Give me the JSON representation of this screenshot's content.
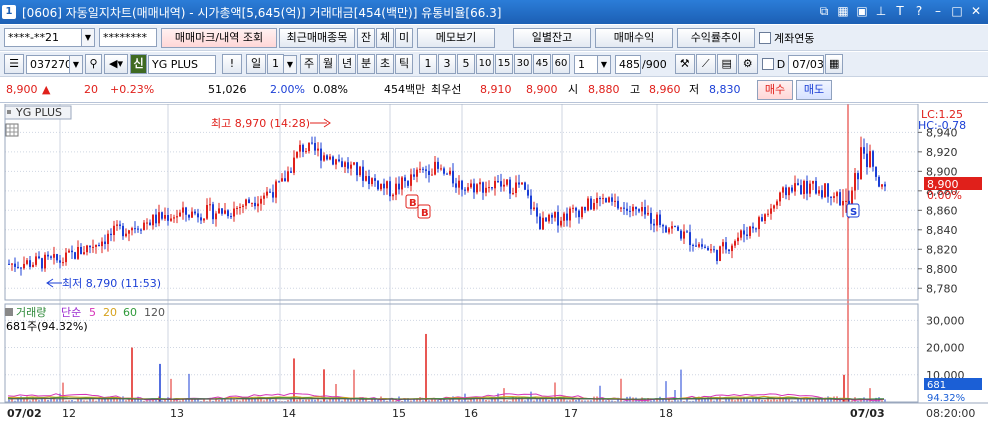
{
  "window": {
    "number": "1",
    "title": "[0606] 자동일지차트(매매내역) - 시가총액[5,645(억)] 거래대금[454(백만)] 유통비율[66.3]"
  },
  "toolbar1": {
    "account": "****-**21",
    "password": "********",
    "trade_mark_button": "매매마크/내역 조회",
    "recent_items_button": "최근매매종목",
    "jan_button": "잔",
    "che_button": "체",
    "mi_button": "미",
    "memo_button": "메모보기",
    "daily_balance_button": "일별잔고",
    "trade_profit_button": "매매수익",
    "return_trend_button": "수익률추이",
    "account_link_label": "계좌연동"
  },
  "toolbar2": {
    "code": "037270",
    "credit_badge": "신",
    "stock_name": "YG PLUS",
    "exclaim_button": "!",
    "period_label": "일",
    "period_count": "1",
    "periods": [
      "주",
      "월",
      "년",
      "분",
      "초",
      "틱"
    ],
    "selected_period": "분",
    "intervals": [
      "1",
      "3",
      "5",
      "10",
      "15",
      "30",
      "45",
      "60"
    ],
    "selected_interval": "1",
    "custom_interval": "1",
    "page_counter": "485",
    "page_total": "/900",
    "d_label": "D",
    "date": "07/03"
  },
  "quote": {
    "price": "8,900",
    "change": "20",
    "change_pct": "+0.23%",
    "volume": "51,026",
    "vol_ratio": "2.00%",
    "turnover": "0.08%",
    "amount": "454백만",
    "best_label": "최우선",
    "ask": "8,910",
    "bid": "8,900",
    "open_label": "시",
    "open": "8,880",
    "high_label": "고",
    "high": "8,960",
    "low_label": "저",
    "low": "8,830",
    "buy_button": "매수",
    "sell_button": "매도"
  },
  "chart_data": {
    "type": "candlestick",
    "symbol_label": "YG PLUS",
    "price_axis": {
      "ticks": [
        "8,940",
        "8,920",
        "8,900",
        "8,880",
        "8,860",
        "8,840",
        "8,820",
        "8,800",
        "8,780"
      ],
      "ylim": [
        8770,
        8965
      ],
      "lc_label": "LC:1.25",
      "hc_label": "HC:-0.78",
      "current_price": "8,900",
      "current_pct": "0.00%"
    },
    "annotations": {
      "high": "최고 8,970 (14:28)",
      "low": "최저 8,790 (11:53)",
      "buy_marks": [
        "B",
        "B"
      ],
      "sell_mark": "S"
    },
    "x_labels": [
      "07/02",
      "12",
      "13",
      "14",
      "15",
      "16",
      "17",
      "18",
      "07/03"
    ],
    "time_label": "08:20:00",
    "volume_panel": {
      "legend": [
        "거래량",
        "단순",
        "5",
        "20",
        "60",
        "120"
      ],
      "legend_colors": [
        "#2f8a3a",
        "#9a2ad0",
        "#d633b8",
        "#d6a21d",
        "#2f9a3a",
        "#555555"
      ],
      "subtitle": "681주(94.32%)",
      "ticks": [
        "30,000",
        "20,000",
        "10,000"
      ],
      "ylim": [
        0,
        36000
      ],
      "current_volume": "681",
      "current_pct": "94.32%"
    },
    "colors": {
      "up": "#e0201b",
      "down": "#1b3fd6",
      "grid": "#cfd6e2"
    }
  }
}
